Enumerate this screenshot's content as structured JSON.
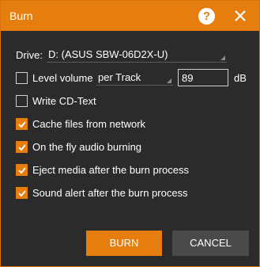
{
  "window": {
    "title": "Burn"
  },
  "drive": {
    "label": "Drive:",
    "value": "D: (ASUS SBW-06D2X-U)"
  },
  "level_volume": {
    "label": "Level volume",
    "checked": false,
    "mode": "per Track",
    "value": "89",
    "unit": "dB"
  },
  "options": [
    {
      "label": "Write CD-Text",
      "checked": false
    },
    {
      "label": "Cache files from network",
      "checked": true
    },
    {
      "label": "On the fly audio burning",
      "checked": true
    },
    {
      "label": "Eject media after the burn process",
      "checked": true
    },
    {
      "label": "Sound alert after the burn process",
      "checked": true
    }
  ],
  "buttons": {
    "burn": "BURN",
    "cancel": "CANCEL"
  },
  "colors": {
    "accent": "#e67e0f",
    "background": "#2b2b2b",
    "cancel": "#4a4a4a"
  }
}
